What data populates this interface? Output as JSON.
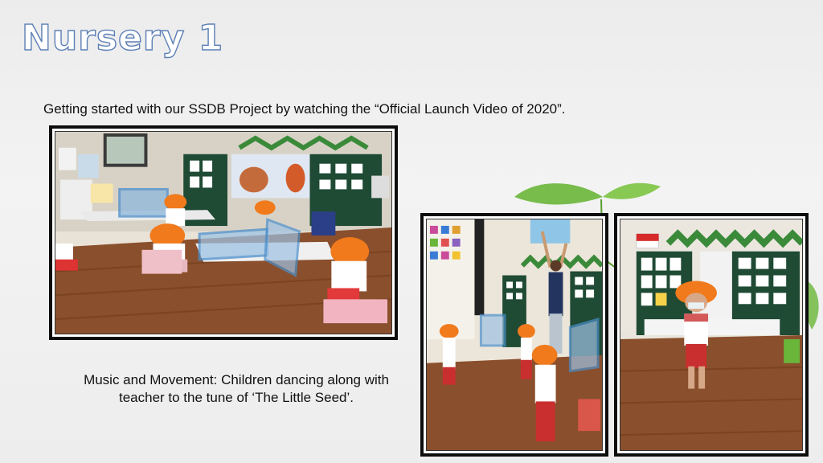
{
  "slide": {
    "title": "Nursery 1",
    "caption_top": "Getting started with our SSDB Project by watching the “Official  Launch Video of 2020”.",
    "caption_bottom_line1": "Music and Movement: Children dancing along with",
    "caption_bottom_line2": "teacher to the tune of ‘The Little Seed’."
  },
  "colors": {
    "title_outline": "#5c7fb6",
    "hat_orange": "#f07a1c",
    "floor_wood": "#8a4f2c",
    "board_green": "#1f4a34",
    "leaf_green": "#6ab63a"
  }
}
